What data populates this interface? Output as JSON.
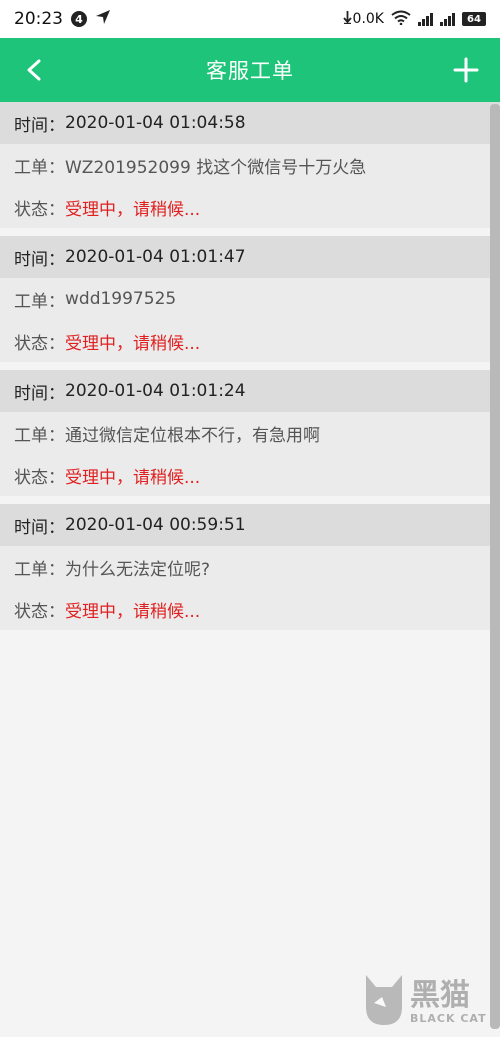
{
  "status_bar": {
    "time": "20:23",
    "notif_badge": "4",
    "net_speed": "0.0K",
    "battery": "64"
  },
  "nav": {
    "title": "客服工单"
  },
  "tickets": [
    {
      "time_label": "时间：",
      "time": "2020-01-04 01:04:58",
      "order_label": "工单：",
      "order": "WZ201952099 找这个微信号十万火急",
      "status_label": "状态：",
      "status": "受理中，请稍候..."
    },
    {
      "time_label": "时间：",
      "time": "2020-01-04 01:01:47",
      "order_label": "工单：",
      "order": "wdd1997525",
      "status_label": "状态：",
      "status": "受理中，请稍候..."
    },
    {
      "time_label": "时间：",
      "time": "2020-01-04 01:01:24",
      "order_label": "工单：",
      "order": "通过微信定位根本不行，有急用啊",
      "status_label": "状态：",
      "status": "受理中，请稍候..."
    },
    {
      "time_label": "时间：",
      "time": "2020-01-04 00:59:51",
      "order_label": "工单：",
      "order": "为什么无法定位呢?",
      "status_label": "状态：",
      "status": "受理中，请稍候..."
    }
  ],
  "colors": {
    "nav_bg": "#1ec47a",
    "status_text": "#e02020"
  },
  "watermark": {
    "cn": "黑猫",
    "en": "BLACK CAT"
  }
}
